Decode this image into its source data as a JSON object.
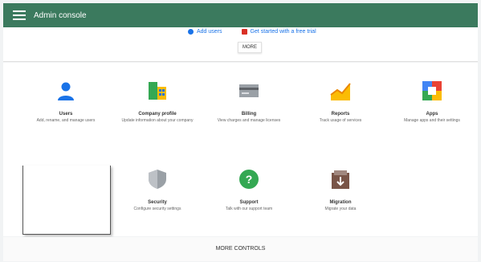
{
  "header": {
    "title": "Admin console"
  },
  "top_links": [
    {
      "label": "Add users",
      "icon": "person-add-icon",
      "color": "#1a73e8"
    },
    {
      "label": "Get started with a free trial",
      "icon": "gift-icon",
      "color": "#d93025"
    }
  ],
  "more_button": "MORE",
  "cards": [
    {
      "name": "Users",
      "desc": "Add, rename, and manage users",
      "icon": "user-icon"
    },
    {
      "name": "Company profile",
      "desc": "Update information about your company",
      "icon": "company-profile-icon"
    },
    {
      "name": "Billing",
      "desc": "View charges and manage licenses",
      "icon": "billing-icon"
    },
    {
      "name": "Reports",
      "desc": "Track usage of services",
      "icon": "reports-icon"
    },
    {
      "name": "Apps",
      "desc": "Manage apps and their settings",
      "icon": "apps-icon"
    },
    {
      "name": "",
      "desc": "",
      "icon": "laptop-icon"
    },
    {
      "name": "Security",
      "desc": "Configure security settings",
      "icon": "security-icon"
    },
    {
      "name": "Support",
      "desc": "Talk with our support team",
      "icon": "support-icon"
    },
    {
      "name": "Migration",
      "desc": "Migrate your data",
      "icon": "migration-icon"
    }
  ],
  "footer": {
    "label": "MORE CONTROLS"
  }
}
